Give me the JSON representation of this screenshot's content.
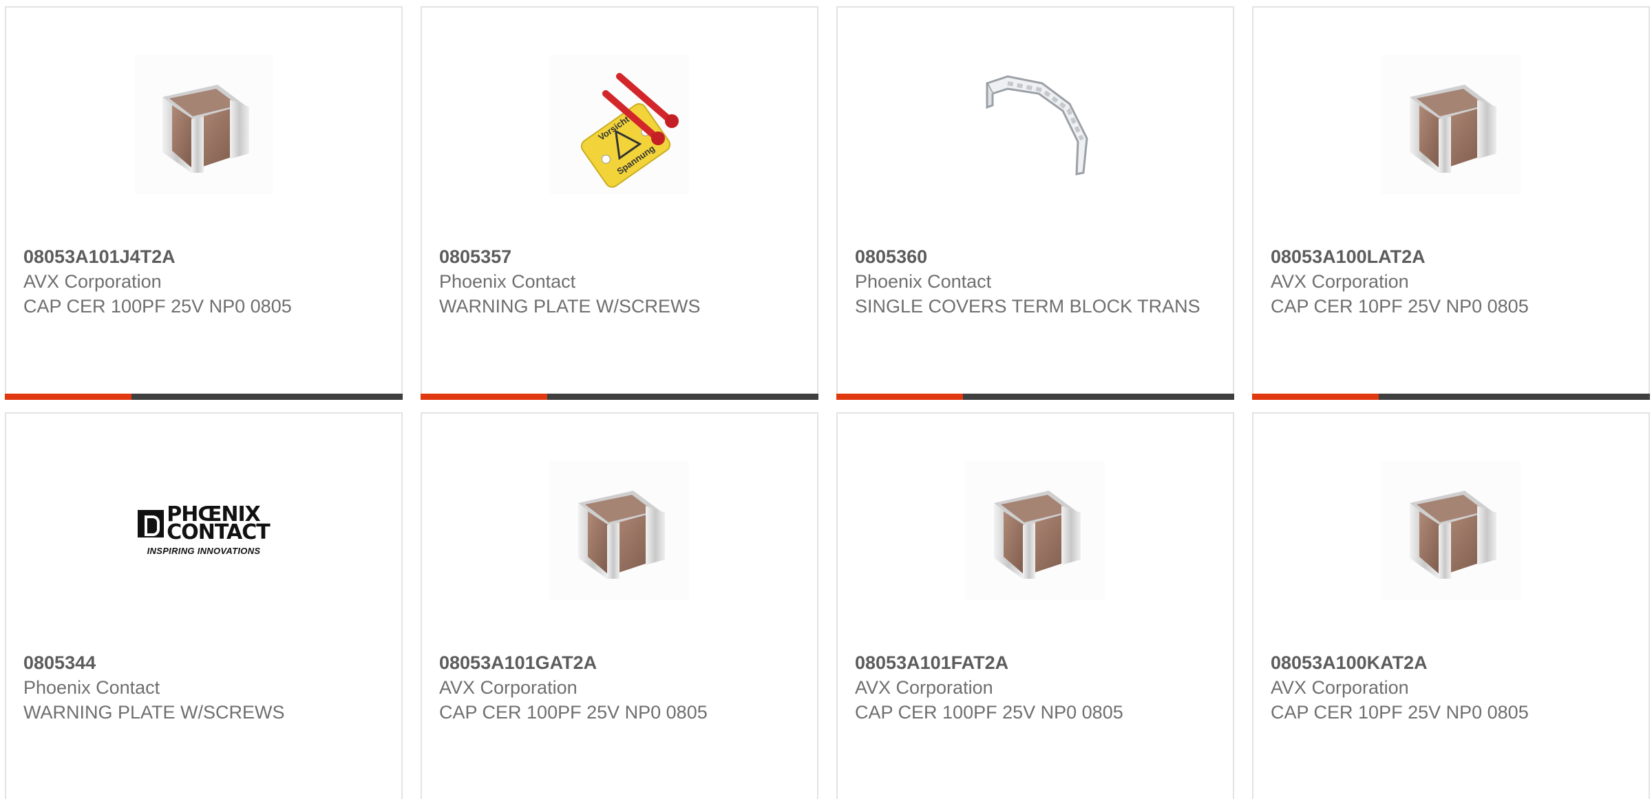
{
  "products": [
    {
      "part": "08053A101J4T2A",
      "maker": "AVX Corporation",
      "desc": "CAP CER 100PF 25V NP0 0805",
      "image": "ceramic-capacitor-icon"
    },
    {
      "part": "0805357",
      "maker": "Phoenix Contact",
      "desc": "WARNING PLATE W/SCREWS",
      "image": "warning-plate-icon"
    },
    {
      "part": "0805360",
      "maker": "Phoenix Contact",
      "desc": "SINGLE COVERS TERM BLOCK TRANS",
      "image": "terminal-cover-icon"
    },
    {
      "part": "08053A100LAT2A",
      "maker": "AVX Corporation",
      "desc": "CAP CER 10PF 25V NP0 0805",
      "image": "ceramic-capacitor-icon"
    },
    {
      "part": "0805344",
      "maker": "Phoenix Contact",
      "desc": "WARNING PLATE W/SCREWS",
      "image": "phoenix-contact-logo"
    },
    {
      "part": "08053A101GAT2A",
      "maker": "AVX Corporation",
      "desc": "CAP CER 100PF 25V NP0 0805",
      "image": "ceramic-capacitor-icon"
    },
    {
      "part": "08053A101FAT2A",
      "maker": "AVX Corporation",
      "desc": "CAP CER 100PF 25V NP0 0805",
      "image": "ceramic-capacitor-icon"
    },
    {
      "part": "08053A100KAT2A",
      "maker": "AVX Corporation",
      "desc": "CAP CER 10PF 25V NP0 0805",
      "image": "ceramic-capacitor-icon"
    }
  ],
  "logo": {
    "line1": "PHŒNIX",
    "line2": "CONTACT",
    "tagline": "INSPIRING INNOVATIONS"
  },
  "colors": {
    "accent": "#e0380f",
    "bar": "#3f3f3f",
    "part_text": "#5c5c5c",
    "body_text": "#6e6e6e",
    "border": "#e3e3e3"
  }
}
